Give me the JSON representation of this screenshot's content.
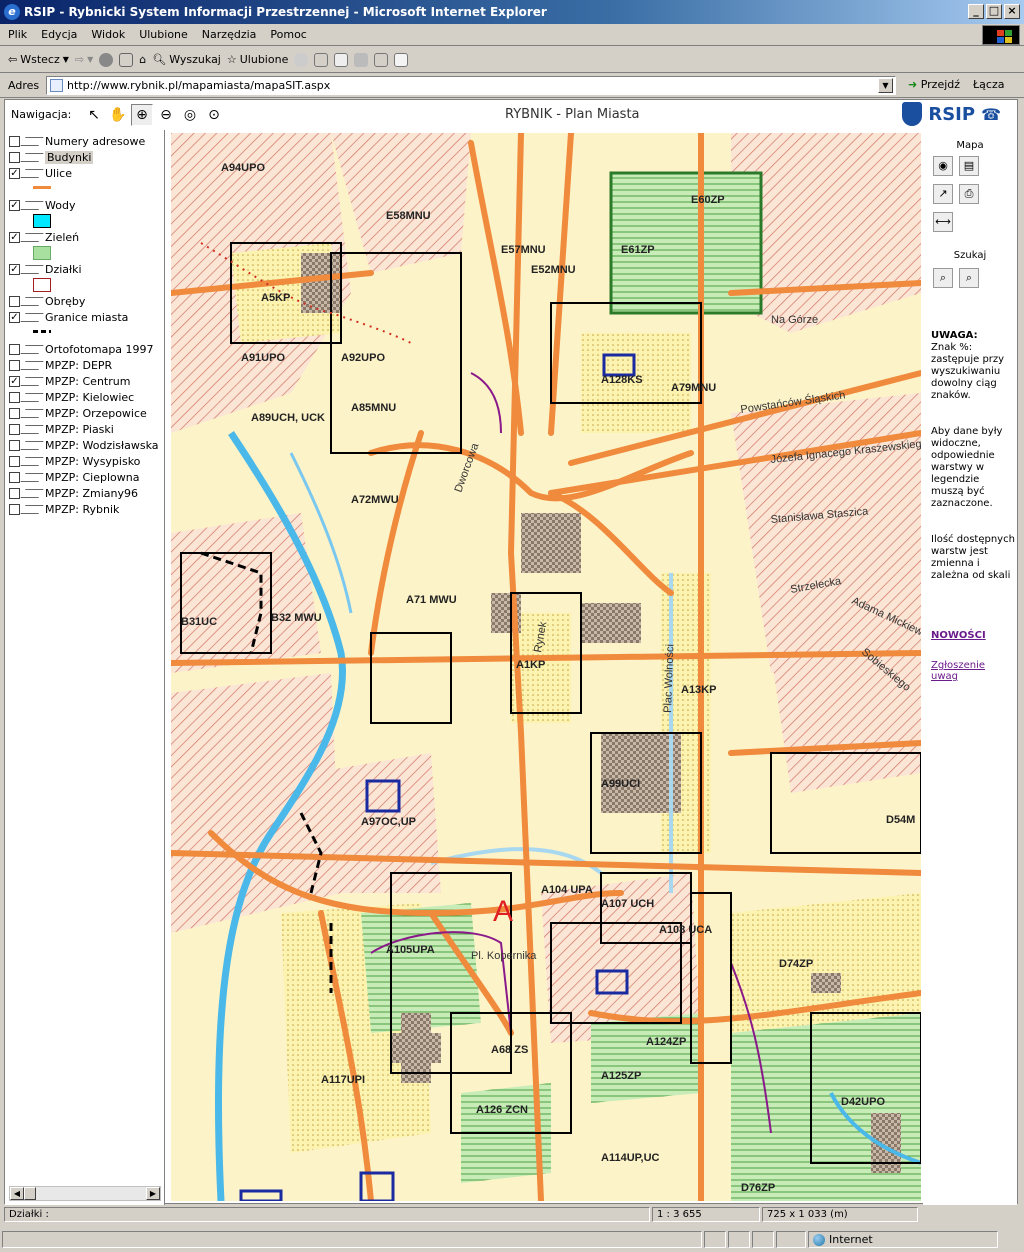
{
  "window": {
    "title": "RSIP - Rybnicki System Informacji Przestrzennej - Microsoft Internet Explorer",
    "buttons": [
      "_",
      "□",
      "×"
    ]
  },
  "menu": [
    "Plik",
    "Edycja",
    "Widok",
    "Ulubione",
    "Narzędzia",
    "Pomoc"
  ],
  "toolbar": {
    "back": "Wstecz",
    "search": "Wyszukaj",
    "favorites": "Ulubione"
  },
  "address": {
    "label": "Adres",
    "url": "http://www.rybnik.pl/mapamiasta/mapaSIT.aspx",
    "go": "Przejdź",
    "links": "Łącza"
  },
  "app": {
    "nav_label": "Nawigacja:",
    "title": "RYBNIK - Plan Miasta",
    "logo": "RSIP"
  },
  "legend": [
    {
      "label": "Numery adresowe",
      "checked": false
    },
    {
      "label": "Budynki",
      "checked": false,
      "highlight": true
    },
    {
      "label": "Ulice",
      "checked": true
    },
    {
      "label": "Wody",
      "checked": true
    },
    {
      "label": "Zieleń",
      "checked": true
    },
    {
      "label": "Działki",
      "checked": true
    },
    {
      "label": "Obręby",
      "checked": false
    },
    {
      "label": "Granice miasta",
      "checked": true
    },
    {
      "label": "Ortofotomapa 1997",
      "checked": false
    },
    {
      "label": "MPZP: DEPR",
      "checked": false
    },
    {
      "label": "MPZP: Centrum",
      "checked": true
    },
    {
      "label": "MPZP: Kielowiec",
      "checked": false
    },
    {
      "label": "MPZP: Orzepowice",
      "checked": false
    },
    {
      "label": "MPZP: Piaski",
      "checked": false
    },
    {
      "label": "MPZP: Wodzisławska",
      "checked": false
    },
    {
      "label": "MPZP: Wysypisko",
      "checked": false
    },
    {
      "label": "MPZP: Cieplowna",
      "checked": false
    },
    {
      "label": "MPZP: Zmiany96",
      "checked": false
    },
    {
      "label": "MPZP: Rybnik",
      "checked": false
    }
  ],
  "side": {
    "map_header": "Mapa",
    "search_header": "Szukaj",
    "note_title": "UWAGA:",
    "note1": "Znak %: zastępuje przy wyszukiwaniu dowolny ciąg znaków.",
    "note2": "Aby dane były widoczne, odpowiednie warstwy w legendzie muszą być zaznaczone.",
    "note3": "Ilość dostępnych warstw jest zmienna i zależna od skali",
    "news": "NOWOŚCI",
    "report": "Zgłoszenie uwag"
  },
  "map": {
    "zones": [
      "A94UPO",
      "E58MNU",
      "E52MNU",
      "E57MNU",
      "E60ZP",
      "E61ZP",
      "A5KP",
      "A91UPO",
      "A92UPO",
      "A89UCH, UCK",
      "A85MNU",
      "A128KS",
      "A79MNU",
      "A72MWU",
      "A1KP",
      "B31UC",
      "B32 MWU",
      "A71 MWU",
      "A13KP",
      "A99UCI",
      "A97OC,UP",
      "A105UPA",
      "A104 UPA",
      "A107 UCH",
      "A108 UCA",
      "D74ZP",
      "A68 ZS",
      "A124ZP",
      "A125ZP",
      "A117UPI",
      "D42UPO",
      "D54M",
      "A126 ZCN",
      "A114UP,UC",
      "D76ZP"
    ],
    "streets": [
      "Na Górze",
      "Powstańców Śląskich",
      "Józefa Ignacego Kraszewskiego",
      "Stanisława Staszica",
      "Strzelecka",
      "Adama Mickiewicza",
      "Pl. Kopernika",
      "Rynek",
      "Plac Wolności",
      "Dworcowa",
      "Sobieskiego"
    ],
    "big_label": "A"
  },
  "status": {
    "left": "Działki :",
    "scale": "1 : 3 655",
    "extent": "725 x 1 033 (m)"
  },
  "ie_status": {
    "zone": "Internet"
  },
  "colors": {
    "title_bar": "#0a246a",
    "road": "#f08a3c",
    "water": "#4ab8e8",
    "green": "#9ad88a",
    "zone_outline": "#000000",
    "hatch": "#d47a6a",
    "map_bg": "#fdf3c8"
  }
}
